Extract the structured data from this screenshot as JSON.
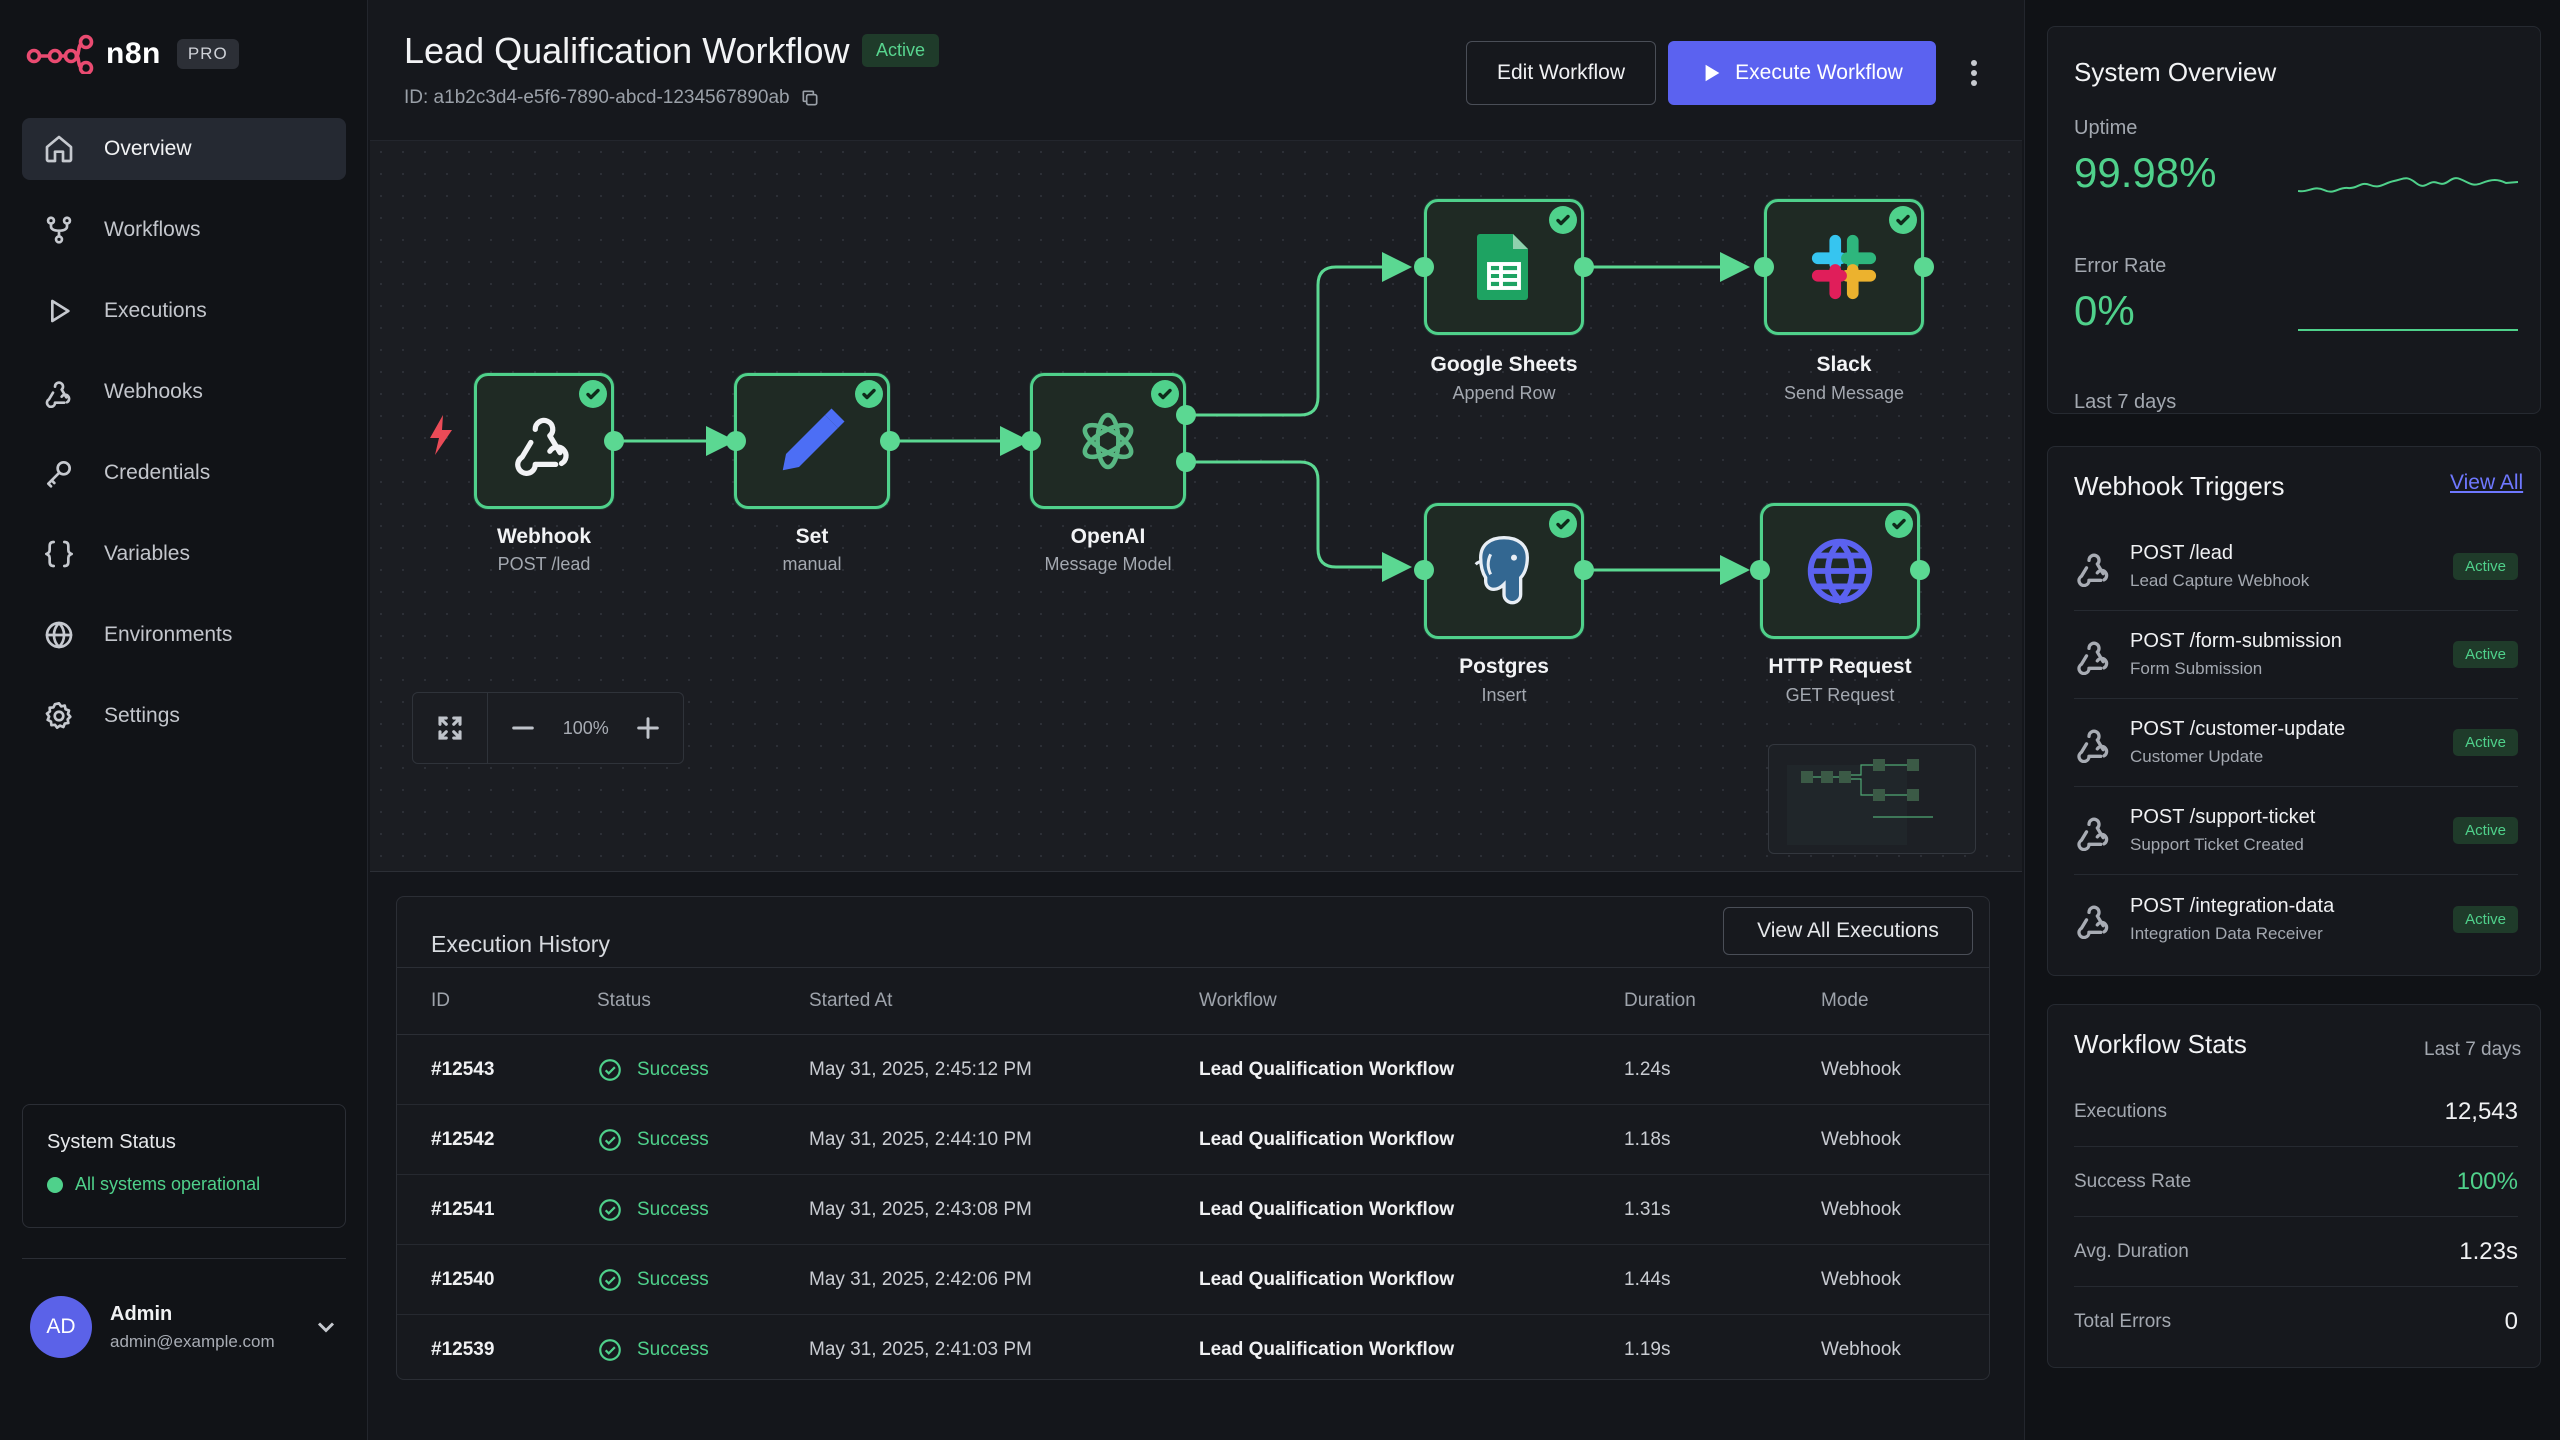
{
  "brand": {
    "name": "n8n",
    "badge": "PRO"
  },
  "sidebar": {
    "items": [
      {
        "label": "Overview",
        "icon": "home-icon",
        "active": true
      },
      {
        "label": "Workflows",
        "icon": "workflow-icon"
      },
      {
        "label": "Executions",
        "icon": "play-icon"
      },
      {
        "label": "Webhooks",
        "icon": "webhook-icon"
      },
      {
        "label": "Credentials",
        "icon": "key-icon"
      },
      {
        "label": "Variables",
        "icon": "braces-icon"
      },
      {
        "label": "Environments",
        "icon": "globe-icon"
      },
      {
        "label": "Settings",
        "icon": "gear-icon"
      }
    ],
    "system_status": {
      "title": "System Status",
      "text": "All systems operational"
    },
    "user": {
      "initials": "AD",
      "name": "Admin",
      "email": "admin@example.com"
    }
  },
  "header": {
    "title": "Lead Qualification Workflow",
    "status": "Active",
    "id": "ID: a1b2c3d4-e5f6-7890-abcd-1234567890ab",
    "edit_label": "Edit Workflow",
    "execute_label": "Execute Workflow"
  },
  "canvas": {
    "zoom": "100%",
    "nodes": [
      {
        "title": "Webhook",
        "subtitle": "POST /lead",
        "icon": "webhook-icon"
      },
      {
        "title": "Set",
        "subtitle": "manual",
        "icon": "pencil-icon"
      },
      {
        "title": "OpenAI",
        "subtitle": "Message Model",
        "icon": "openai-icon"
      },
      {
        "title": "Google Sheets",
        "subtitle": "Append Row",
        "icon": "google-sheets-icon"
      },
      {
        "title": "Slack",
        "subtitle": "Send Message",
        "icon": "slack-icon"
      },
      {
        "title": "Postgres",
        "subtitle": "Insert",
        "icon": "postgres-icon"
      },
      {
        "title": "HTTP Request",
        "subtitle": "GET Request",
        "icon": "globe-icon"
      }
    ]
  },
  "history": {
    "title": "Execution History",
    "view_all_label": "View All Executions",
    "columns": [
      "ID",
      "Status",
      "Started At",
      "Workflow",
      "Duration",
      "Mode"
    ],
    "rows": [
      {
        "id": "#12543",
        "status": "Success",
        "started": "May 31, 2025, 2:45:12 PM",
        "workflow": "Lead Qualification Workflow",
        "duration": "1.24s",
        "mode": "Webhook"
      },
      {
        "id": "#12542",
        "status": "Success",
        "started": "May 31, 2025, 2:44:10 PM",
        "workflow": "Lead Qualification Workflow",
        "duration": "1.18s",
        "mode": "Webhook"
      },
      {
        "id": "#12541",
        "status": "Success",
        "started": "May 31, 2025, 2:43:08 PM",
        "workflow": "Lead Qualification Workflow",
        "duration": "1.31s",
        "mode": "Webhook"
      },
      {
        "id": "#12540",
        "status": "Success",
        "started": "May 31, 2025, 2:42:06 PM",
        "workflow": "Lead Qualification Workflow",
        "duration": "1.44s",
        "mode": "Webhook"
      },
      {
        "id": "#12539",
        "status": "Success",
        "started": "May 31, 2025, 2:41:03 PM",
        "workflow": "Lead Qualification Workflow",
        "duration": "1.19s",
        "mode": "Webhook"
      }
    ]
  },
  "system_overview": {
    "title": "System Overview",
    "uptime_label": "Uptime",
    "uptime_value": "99.98%",
    "error_label": "Error Rate",
    "error_value": "0%",
    "footer": "Last 7 days"
  },
  "webhook_triggers": {
    "title": "Webhook Triggers",
    "view_all": "View All",
    "items": [
      {
        "title": "POST /lead",
        "subtitle": "Lead Capture Webhook",
        "badge": "Active"
      },
      {
        "title": "POST /form-submission",
        "subtitle": "Form Submission",
        "badge": "Active"
      },
      {
        "title": "POST /customer-update",
        "subtitle": "Customer Update",
        "badge": "Active"
      },
      {
        "title": "POST /support-ticket",
        "subtitle": "Support Ticket Created",
        "badge": "Active"
      },
      {
        "title": "POST /integration-data",
        "subtitle": "Integration Data Receiver",
        "badge": "Active"
      }
    ]
  },
  "workflow_stats": {
    "title": "Workflow Stats",
    "range": "Last 7 days",
    "rows": [
      {
        "label": "Executions",
        "value": "12,543"
      },
      {
        "label": "Success Rate",
        "value": "100%"
      },
      {
        "label": "Avg. Duration",
        "value": "1.23s"
      },
      {
        "label": "Total Errors",
        "value": "0"
      }
    ]
  },
  "colors": {
    "accent": "#5b62f0",
    "success": "#4fd18b",
    "background": "#14161b"
  }
}
